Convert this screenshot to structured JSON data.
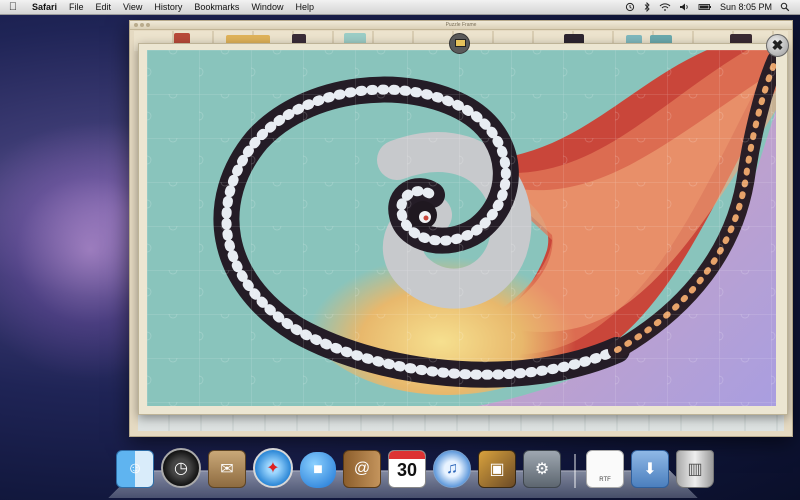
{
  "menubar": {
    "apple_icon": "apple-icon",
    "app_name": "Safari",
    "menus": [
      "File",
      "Edit",
      "View",
      "History",
      "Bookmarks",
      "Window",
      "Help"
    ],
    "clock": "Sun 8:05 PM",
    "status_icons": [
      "time-machine-icon",
      "bluetooth-icon",
      "wifi-icon",
      "volume-icon",
      "battery-icon",
      "spotlight-icon"
    ]
  },
  "browser": {
    "window_title": "Puzzle Frame"
  },
  "puzzle": {
    "close_label": "✖",
    "preview_icon": "picture-icon",
    "image_subject": "fractal spiral jigsaw puzzle"
  },
  "dock": {
    "items": [
      {
        "name": "Finder",
        "icon": "finder-icon"
      },
      {
        "name": "Dashboard",
        "icon": "dashboard-icon"
      },
      {
        "name": "Mail",
        "icon": "mail-icon"
      },
      {
        "name": "Safari",
        "icon": "safari-icon"
      },
      {
        "name": "iChat",
        "icon": "ichat-icon"
      },
      {
        "name": "Address Book",
        "icon": "addressbook-icon"
      },
      {
        "name": "iCal",
        "icon": "ical-icon"
      },
      {
        "name": "iTunes",
        "icon": "itunes-icon"
      },
      {
        "name": "iPhoto",
        "icon": "iphoto-icon"
      },
      {
        "name": "System Preferences",
        "icon": "prefs-icon"
      }
    ],
    "ical_day": "30",
    "document_label": "RTF",
    "stacks": [
      {
        "name": "RTF document",
        "icon": "rtf-document-icon"
      },
      {
        "name": "Downloads",
        "icon": "downloads-folder-icon"
      },
      {
        "name": "Trash",
        "icon": "trash-icon"
      }
    ]
  },
  "colors": {
    "menubar": "#dcdcdc",
    "window_frame": "#e5dac2",
    "fractal_teal": "#8fc5bf",
    "fractal_red": "#c9463a",
    "fractal_lavender": "#b6a9dd",
    "fractal_gold": "#ecc36a"
  }
}
